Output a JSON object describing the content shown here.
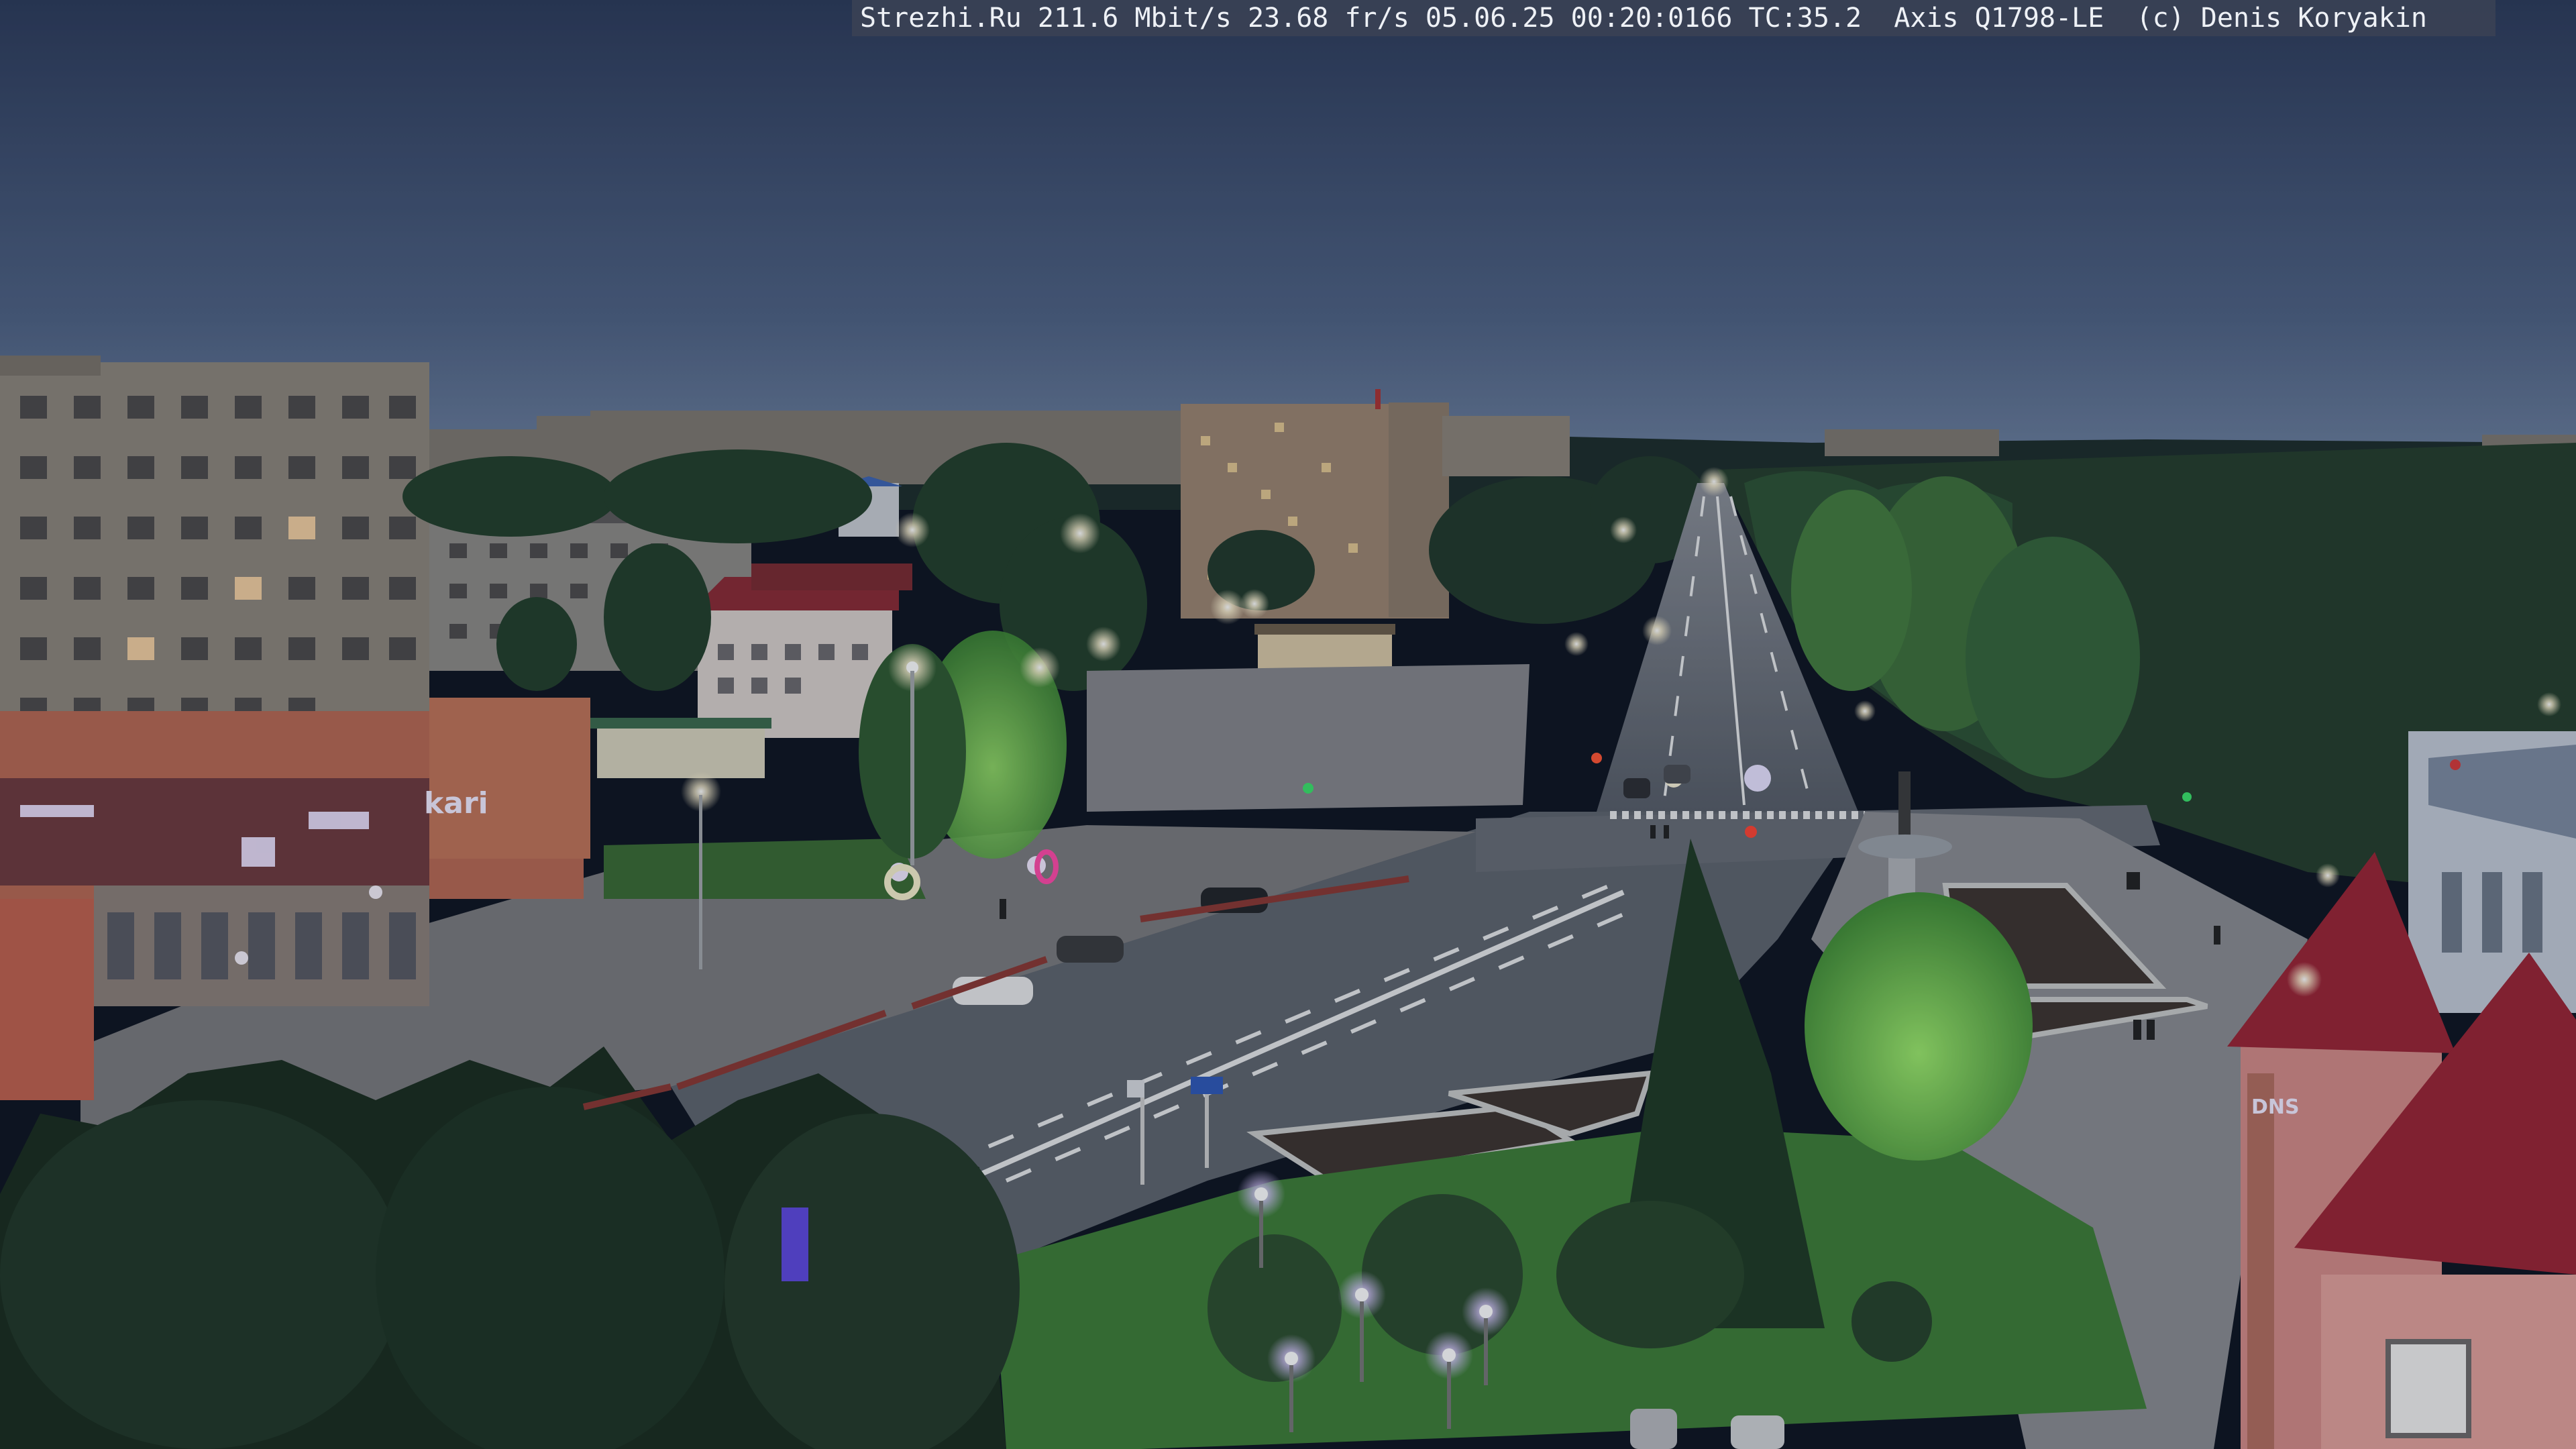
{
  "osd": {
    "text": "Strezhi.Ru 211.6 Mbit/s 23.68 fr/s 05.06.25 00:20:0166 TC:35.2  Axis Q1798-LE  (c) Denis Koryakin"
  },
  "signs": {
    "shop_left": "kari",
    "store_right": "DNS"
  },
  "colors": {
    "sky_top": "#2e3d5c",
    "sky_horizon": "#6a7d9a",
    "road": "#5c6470",
    "square": "#77787c",
    "grass": "#3c7a3a",
    "trees": "#1f3a24",
    "building_panel": "#8a7e72",
    "roof_red": "#9e2a32",
    "lamp_glow": "#fff6d8"
  }
}
